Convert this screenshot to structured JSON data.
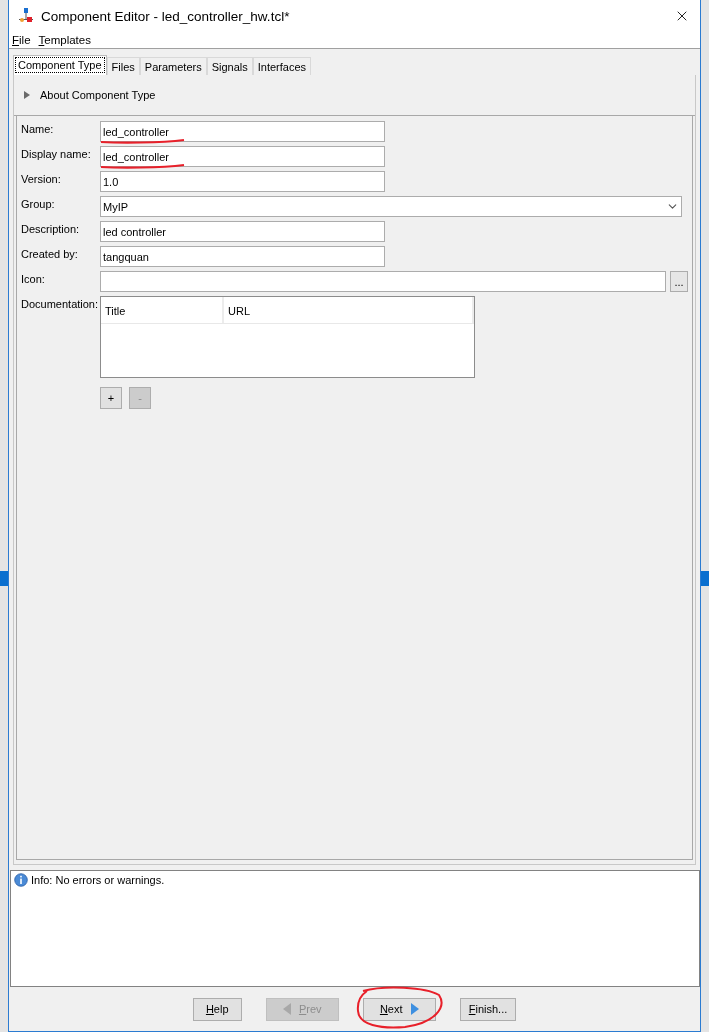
{
  "window": {
    "title": "Component Editor - led_controller_hw.tcl*"
  },
  "menu": [
    {
      "label": "File"
    },
    {
      "label": "Templates"
    }
  ],
  "tabs": [
    {
      "label": "Component Type",
      "selected": true
    },
    {
      "label": "Files",
      "selected": false
    },
    {
      "label": "Parameters",
      "selected": false
    },
    {
      "label": "Signals",
      "selected": false
    },
    {
      "label": "Interfaces",
      "selected": false
    }
  ],
  "section": {
    "label": "About Component Type",
    "expanded": false
  },
  "fields": [
    {
      "label": "Name:",
      "value": "led_controller",
      "kind": "text",
      "underlined": true
    },
    {
      "label": "Display name:",
      "value": "led_controller",
      "kind": "text",
      "underlined": true
    },
    {
      "label": "Version:",
      "value": "1.0",
      "kind": "text",
      "underlined": false
    },
    {
      "label": "Group:",
      "value": "MyIP",
      "kind": "combo",
      "underlined": false
    },
    {
      "label": "Description:",
      "value": "led controller",
      "kind": "text",
      "underlined": false
    },
    {
      "label": "Created by:",
      "value": "tangquan",
      "kind": "text",
      "underlined": false
    },
    {
      "label": "Icon:",
      "kind": "browse",
      "browse_label": "...",
      "underlined": false
    }
  ],
  "documentation": {
    "label": "Documentation:",
    "columns": [
      "Title",
      "URL"
    ],
    "buttons": [
      {
        "label": "+",
        "disabled": false
      },
      {
        "label": "-",
        "disabled": true
      }
    ]
  },
  "info": {
    "message": "Info: No errors or warnings."
  },
  "buttons": [
    {
      "label": "Help",
      "kind": "plain",
      "disabled": false,
      "circled": false
    },
    {
      "label": "Prev",
      "kind": "back",
      "disabled": true,
      "circled": false
    },
    {
      "label": "Next",
      "kind": "forward",
      "disabled": false,
      "circled": true
    },
    {
      "label": "Finish...",
      "kind": "plain",
      "disabled": false,
      "circled": false
    }
  ]
}
